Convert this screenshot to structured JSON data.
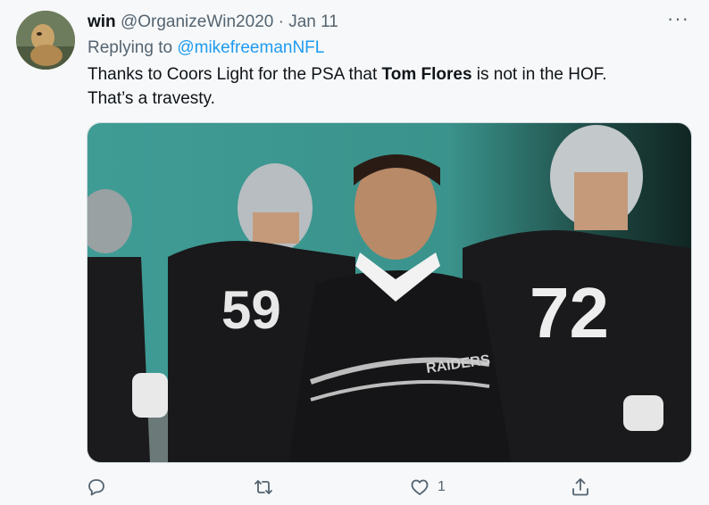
{
  "tweet": {
    "name": "win",
    "handle": "@OrganizeWin2020",
    "separator": "·",
    "date": "Jan 11",
    "more_label": "···",
    "reply_prefix": "Replying to",
    "reply_to": "@mikefreemanNFL",
    "text_part1": "Thanks to Coors Light for the PSA that ",
    "text_bold": "Tom Flores",
    "text_part2": " is not in the HOF.",
    "text_line2": "That’s a travesty.",
    "photo": {
      "jersey_left": "59",
      "jersey_right": "72",
      "sweater_text": "RAIDERS"
    }
  },
  "actions": {
    "reply_icon": "reply-icon",
    "retweet_icon": "retweet-icon",
    "like_icon": "heart-icon",
    "like_count": "1",
    "share_icon": "share-icon"
  },
  "colors": {
    "background": "#f7f8f9",
    "text": "#0f1419",
    "secondary": "#536471",
    "link": "#1d9bf0"
  }
}
